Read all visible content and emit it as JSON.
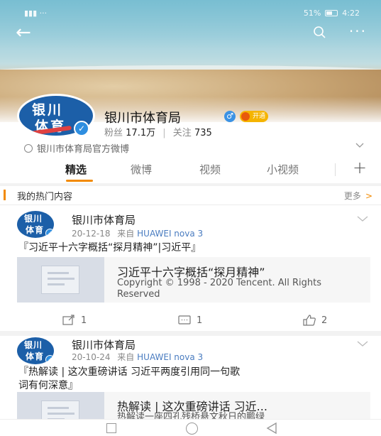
{
  "status_bar": {
    "left": "▮▮▮ ‧‧‧",
    "battery": "51%",
    "time": "4:22"
  },
  "profile": {
    "avatar_line1": "银川",
    "avatar_line2": "体育",
    "name": "银川市体育局",
    "gender_icon": "♂",
    "vip_label": "开通",
    "fans_label": "粉丝",
    "fans_value": "17.1万",
    "follow_label": "关注",
    "follow_value": "735",
    "official_text": "银川市体育局官方微博"
  },
  "tabs": [
    {
      "label": "精选"
    },
    {
      "label": "微博"
    },
    {
      "label": "视频"
    },
    {
      "label": "小视频"
    }
  ],
  "tab_plus": "+",
  "hot": {
    "title": "我的热门内容",
    "more": "更多",
    "more_arrow": ">"
  },
  "posts": [
    {
      "author": "银川市体育局",
      "date": "20-12-18",
      "from_label": "来自",
      "device": "HUAWEI nova 3",
      "text": "『习近平十六字概括“探月精神”|习近平』",
      "card_title": "习近平十六字概括“探月精神”",
      "card_desc": "Copyright © 1998 - 2020 Tencent. All Rights Reserved",
      "repost_count": "1",
      "comment_count": "1",
      "like_count": "2"
    },
    {
      "author": "银川市体育局",
      "date": "20-10-24",
      "from_label": "来自",
      "device": "HUAWEI nova 3",
      "text_line1": "『热解读 | 这次重磅讲话 习近平两度引用同一句歌",
      "text_line2": "词有何深意』",
      "card_title": "热解读 | 这次重磅讲话 习近...",
      "card_desc": "热解读一座四孔残桥悬文秋日的鹏绿"
    }
  ],
  "colors": {
    "accent": "#f28a00",
    "verified": "#2e8ee0",
    "link": "#4a7cc0",
    "avatar_bg": "#1c5fa8"
  }
}
